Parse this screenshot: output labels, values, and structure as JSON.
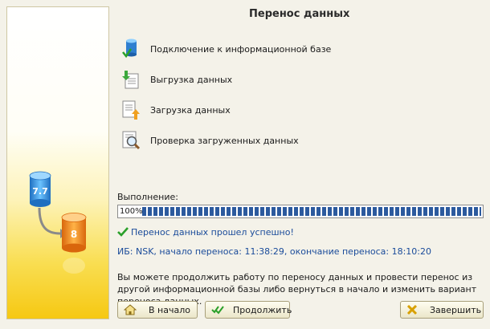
{
  "title": "Перенос данных",
  "left_panel": {
    "source_version": "7.7",
    "target_version": "8"
  },
  "steps": [
    {
      "label": "Подключение к информационной базе",
      "icon": "database-connect-icon"
    },
    {
      "label": "Выгрузка данных",
      "icon": "export-data-icon"
    },
    {
      "label": "Загрузка данных",
      "icon": "import-data-icon"
    },
    {
      "label": "Проверка загруженных данных",
      "icon": "check-data-magnifier-icon"
    }
  ],
  "execution": {
    "label": "Выполнение:",
    "percent_text": "100%",
    "progress": 100
  },
  "status": {
    "message": "Перенос данных прошел успешно!",
    "icon": "checkmark-icon",
    "color": "#1a4b9a"
  },
  "info": "ИБ: NSK, начало переноса: 11:38:29, окончание переноса: 18:10:20",
  "hint": "Вы можете продолжить работу по переносу данных и провести перенос из другой информационной базы либо вернуться в начало и изменить вариант переноса данных.",
  "buttons": {
    "home": "В начало",
    "continue": "Продолжить",
    "finish": "Завершить"
  },
  "colors": {
    "progress_fill": "#2c5a9e",
    "panel_yellow": "#f6c812",
    "source_db": "#3a8fd6",
    "target_db": "#f0921a"
  }
}
